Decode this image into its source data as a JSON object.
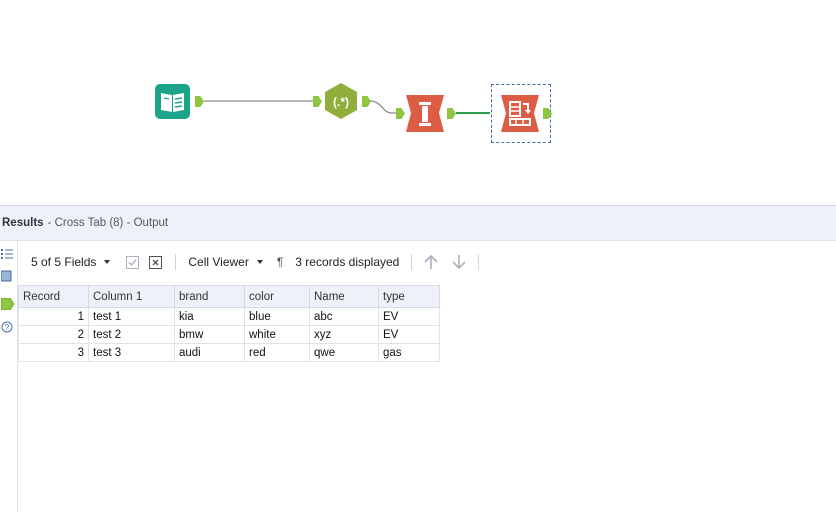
{
  "canvas": {
    "tools": [
      {
        "name": "input-data-tool",
        "icon": "book-icon",
        "color": "#1aa58a"
      },
      {
        "name": "regex-tool",
        "icon": "regex-icon",
        "label": "(.*)",
        "color": "#8fae3c"
      },
      {
        "name": "transpose-tool",
        "icon": "transpose-icon",
        "color": "#dd5c45"
      },
      {
        "name": "cross-tab-tool",
        "icon": "cross-tab-icon",
        "color": "#dd5c45"
      }
    ]
  },
  "results": {
    "title": "Results",
    "subtitle": "- Cross Tab (8) - Output"
  },
  "toolbar": {
    "fields_label": "5 of 5 Fields",
    "viewer_label": "Cell Viewer",
    "pilcrow": "¶",
    "records_label": "3 records displayed"
  },
  "grid": {
    "columns": [
      "Record",
      "Column 1",
      "brand",
      "color",
      "Name",
      "type"
    ],
    "rows": [
      [
        "1",
        "test 1",
        "kia",
        "blue",
        "abc",
        "EV"
      ],
      [
        "2",
        "test 2",
        "bmw",
        "white",
        "xyz",
        "EV"
      ],
      [
        "3",
        "test 3",
        "audi",
        "red",
        "qwe",
        "gas"
      ]
    ]
  },
  "colors": {
    "anchor_green": "#8ec63f",
    "teal": "#1aa58a",
    "orange_red": "#dd5c45",
    "olive": "#8fae3c"
  }
}
